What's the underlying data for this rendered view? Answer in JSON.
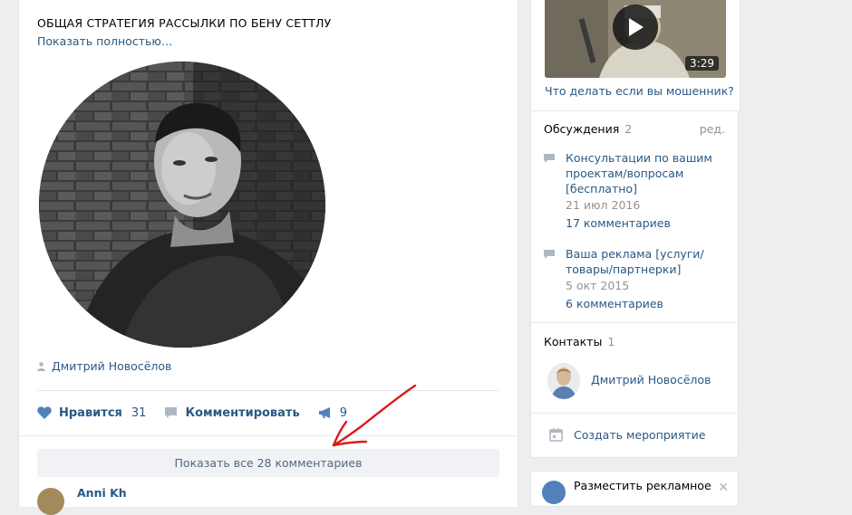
{
  "post": {
    "title": "ОБЩАЯ СТРАТЕГИЯ РАССЫЛКИ ПО БЕНУ СЕТТЛУ",
    "show_more": "Показать полностью…",
    "author": "Дмитрий Новосёлов",
    "actions": {
      "like_label": "Нравится",
      "like_count": "31",
      "comment_label": "Комментировать",
      "share_count": "9"
    },
    "show_all_comments": "Показать все 28 комментариев",
    "comment_peek_name": "Anni Kh"
  },
  "sidebar": {
    "video": {
      "duration": "3:29",
      "title": "Что делать если вы мошенник?"
    },
    "discussions": {
      "header": "Обсуждения",
      "count": "2",
      "edit": "ред.",
      "items": [
        {
          "title": "Консультации по вашим проектам/вопросам [бесплатно]",
          "date": "21 июл 2016",
          "comments": "17 комментариев"
        },
        {
          "title": "Ваша реклама [услуги/товары/партнерки]",
          "date": "5 окт 2015",
          "comments": "6 комментариев"
        }
      ]
    },
    "contacts": {
      "header": "Контакты",
      "count": "1",
      "name": "Дмитрий Новосёлов"
    },
    "create_event": "Создать мероприятие",
    "ad": {
      "label": "Разместить рекламное"
    }
  },
  "colors": {
    "link": "#2a5885",
    "muted": "#939393",
    "background": "#edeef0"
  }
}
